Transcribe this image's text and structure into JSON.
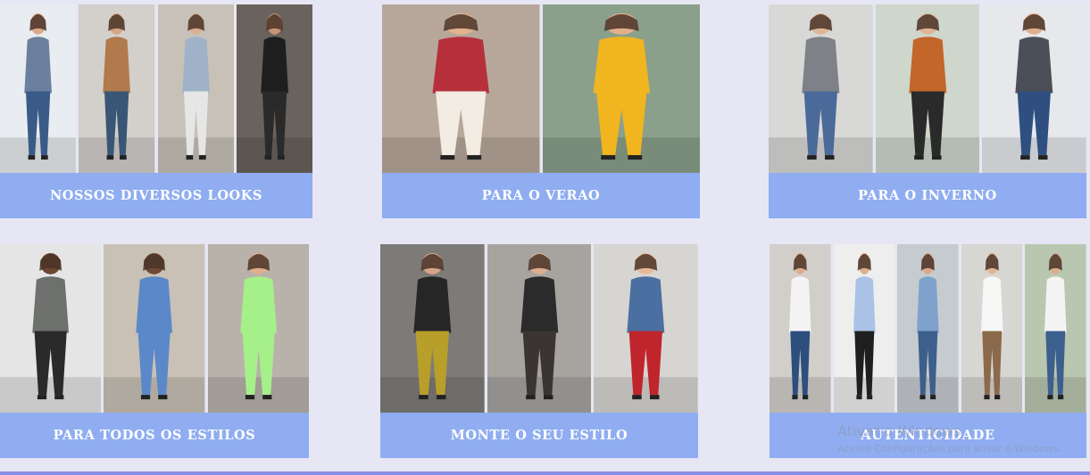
{
  "cards": [
    {
      "label": "NOSSOS DIVERSOS LOOKS",
      "photo_icon": "outfit-photo",
      "photos": [
        {
          "bg": "#e9ecf0",
          "top": "#6b7f9e",
          "bottom": "#3a5a88",
          "skin": "#d9a98a"
        },
        {
          "bg": "#d3cfcb",
          "top": "#b07a4c",
          "bottom": "#3a5676",
          "skin": "#d7a584"
        },
        {
          "bg": "#c7c1b8",
          "top": "#9fb2c8",
          "bottom": "#e6e6e6",
          "skin": "#dcae90"
        },
        {
          "bg": "#6a625c",
          "top": "#1e1e1e",
          "bottom": "#2a2a2a",
          "skin": "#c99376"
        }
      ]
    },
    {
      "label": "PARA O VERAO",
      "photo_icon": "outfit-photo",
      "photos": [
        {
          "bg": "#b7a79a",
          "top": "#b6303b",
          "bottom": "#f2ece3",
          "skin": "#e2b38f"
        },
        {
          "bg": "#8aa08a",
          "top": "#f1b51f",
          "bottom": "#f1b51f",
          "skin": "#e4b08c"
        }
      ]
    },
    {
      "label": "PARA O INVERNO",
      "photo_icon": "outfit-photo",
      "photos": [
        {
          "bg": "#d8d8d6",
          "top": "#7e8288",
          "bottom": "#4a6a99",
          "skin": "#e0b597"
        },
        {
          "bg": "#cfd6cc",
          "top": "#c2662a",
          "bottom": "#2a2a2a",
          "skin": "#e0b597"
        },
        {
          "bg": "#e6e8ec",
          "top": "#4b4f57",
          "bottom": "#2e4f80",
          "skin": "#deb090"
        }
      ]
    },
    {
      "label": "PARA TODOS OS ESTILOS",
      "photo_icon": "outfit-photo",
      "photos": [
        {
          "bg": "#e5e5e5",
          "top": "#6d706c",
          "bottom": "#2a2a2a",
          "skin": "#6b4631"
        },
        {
          "bg": "#c9c1b6",
          "top": "#5b88c8",
          "bottom": "#5b88c8",
          "skin": "#6e4a34"
        },
        {
          "bg": "#b8b2aa",
          "top": "#a6f08a",
          "bottom": "#a6f08a",
          "skin": "#e0ae8e"
        }
      ]
    },
    {
      "label": "MONTE O SEU ESTILO",
      "photo_icon": "outfit-photo",
      "photos": [
        {
          "bg": "#7d7b78",
          "top": "#262626",
          "bottom": "#b89f2a",
          "skin": "#d8a486"
        },
        {
          "bg": "#a7a4a0",
          "top": "#2b2b2b",
          "bottom": "#3a3532",
          "skin": "#dcae90"
        },
        {
          "bg": "#d7d5d2",
          "top": "#4a6fa0",
          "bottom": "#c0252d",
          "skin": "#e6b898"
        }
      ]
    },
    {
      "label": "AUTENTICIDADE",
      "photo_icon": "outfit-photo",
      "photos": [
        {
          "bg": "#d2cfcb",
          "top": "#f4f4f4",
          "bottom": "#2d4f7e",
          "skin": "#dcae90"
        },
        {
          "bg": "#eeeeee",
          "top": "#a9c2e6",
          "bottom": "#1f1f1f",
          "skin": "#dcae90"
        },
        {
          "bg": "#c6cbd0",
          "top": "#7ea2cc",
          "bottom": "#3c5f8c",
          "skin": "#d8a88a"
        },
        {
          "bg": "#d8d6d2",
          "top": "#f7f7f7",
          "bottom": "#8a6a4a",
          "skin": "#e0b597"
        },
        {
          "bg": "#b9c7b0",
          "top": "#f4f4f4",
          "bottom": "#3d5f8e",
          "skin": "#dcae90"
        }
      ]
    }
  ],
  "watermark": {
    "title": "Ativar o Windows",
    "subtitle": "Acesse Configurações para ativar o Windows."
  }
}
